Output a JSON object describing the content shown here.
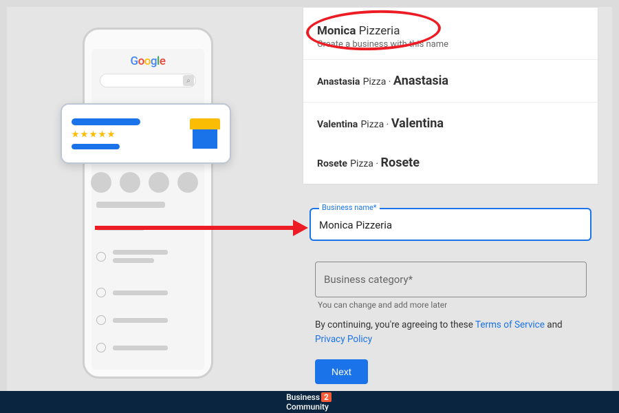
{
  "phone": {
    "logo_parts": [
      "G",
      "o",
      "o",
      "g",
      "l",
      "e"
    ]
  },
  "suggestions": {
    "create": {
      "bold": "Monica",
      "rest": " Pizzeria",
      "subtitle": "Create a business with this name"
    },
    "items": [
      {
        "bold": "Anastasia",
        "type": "Pizza",
        "sep": " · ",
        "name": "Anastasia"
      },
      {
        "bold": "Valentina",
        "type": "Pizza",
        "sep": " · ",
        "name": "Valentina"
      },
      {
        "bold": "Rosete",
        "type": "Pizza",
        "sep": " · ",
        "name": "Rosete"
      }
    ]
  },
  "form": {
    "name_label": "Business name*",
    "name_value": "Monica Pizzeria",
    "category_placeholder": "Business category*",
    "hint": "You can change and add more later",
    "consent_pre": "By continuing, you're agreeing to these ",
    "tos": "Terms of Service",
    "and": " and ",
    "pp": "Privacy Policy",
    "next": "Next"
  },
  "footer": {
    "brand_a": "Business",
    "brand_b": "2",
    "brand_c": "Community"
  }
}
